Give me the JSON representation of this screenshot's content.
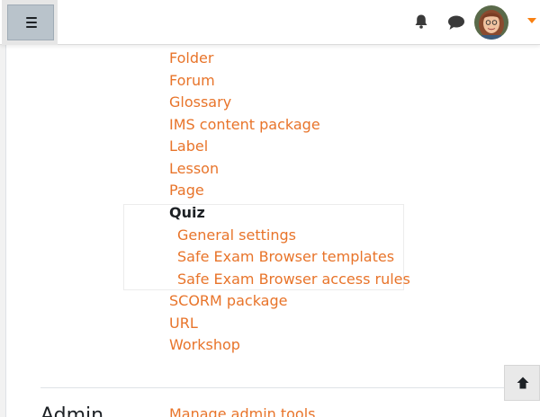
{
  "header": {
    "menu_icon": "hamburger-icon",
    "notifications_icon": "bell-icon",
    "messages_icon": "chat-bubble-icon",
    "user_menu_icon": "caret-down-icon",
    "accent_color": "#f98012"
  },
  "plugins": {
    "items_before": [
      {
        "label": "Folder"
      },
      {
        "label": "Forum"
      },
      {
        "label": "Glossary"
      },
      {
        "label": "IMS content package"
      },
      {
        "label": "Label"
      },
      {
        "label": "Lesson"
      },
      {
        "label": "Page"
      }
    ],
    "current": {
      "label": "Quiz"
    },
    "sub_items": [
      {
        "label": "General settings"
      },
      {
        "label": "Safe Exam Browser templates"
      },
      {
        "label": "Safe Exam Browser access rules"
      }
    ],
    "items_after": [
      {
        "label": "SCORM package"
      },
      {
        "label": "URL"
      },
      {
        "label": "Workshop"
      }
    ]
  },
  "admin": {
    "heading": "Admin",
    "first_link": "Manage admin tools"
  },
  "back_to_top_icon": "arrow-up-icon",
  "link_color": "#e8742a"
}
